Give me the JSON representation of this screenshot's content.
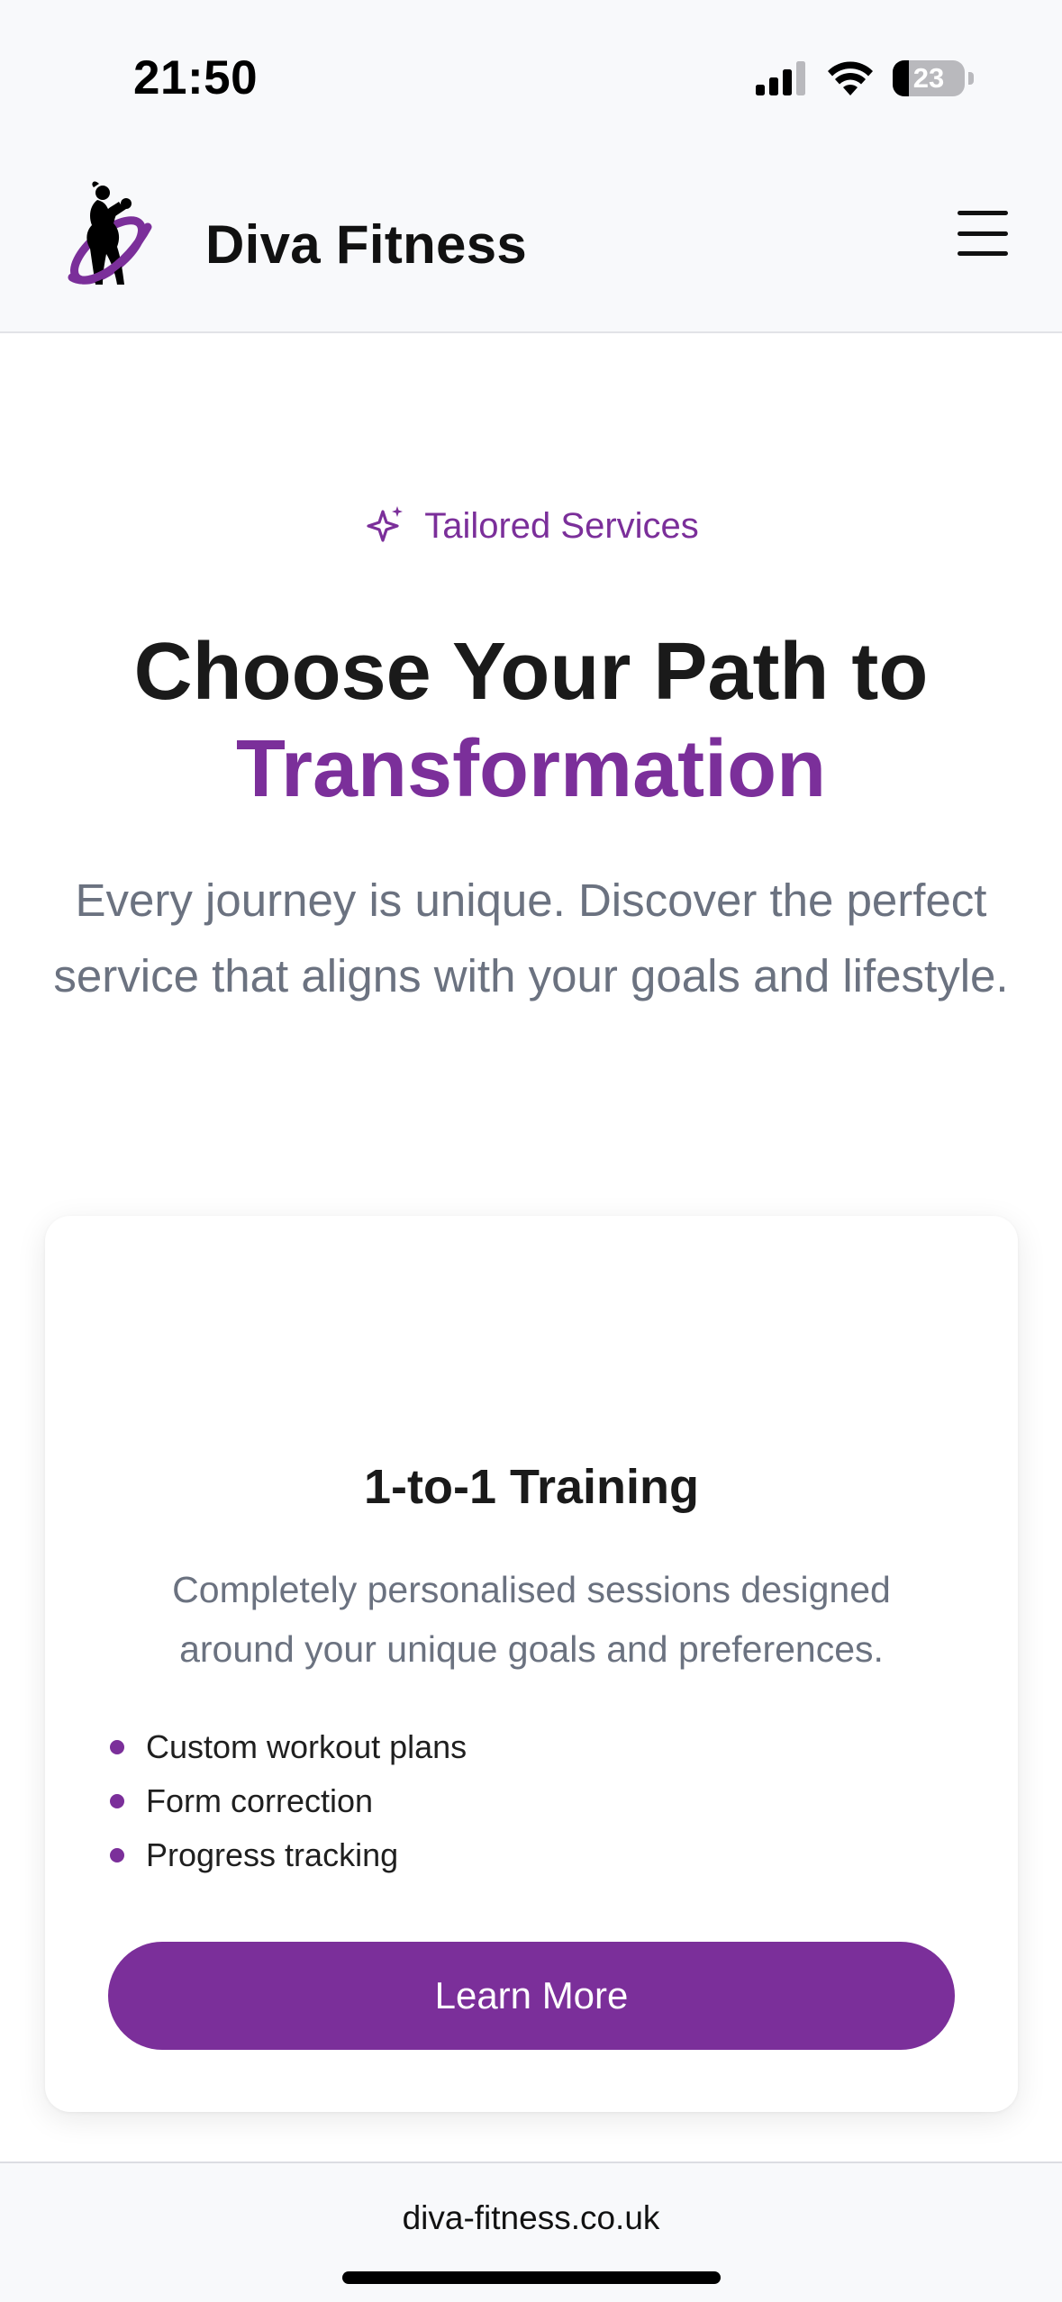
{
  "status_bar": {
    "time": "21:50",
    "battery_percent": "23",
    "battery_level": 0.23,
    "icons": [
      "cellular-signal-icon",
      "wifi-icon",
      "battery-icon"
    ]
  },
  "header": {
    "brand_name": "Diva Fitness",
    "logo_icon": "diva-fitness-logo",
    "menu_icon": "hamburger-menu-icon"
  },
  "intro": {
    "eyebrow_icon": "sparkle-icon",
    "eyebrow": "Tailored Services",
    "headline_line1": "Choose Your Path to",
    "headline_line2": "Transformation",
    "lede": "Every journey is unique. Discover the perfect service that aligns with your goals and lifestyle."
  },
  "service_card": {
    "title": "1-to-1 Training",
    "description": "Completely personalised sessions designed around your unique goals and preferences.",
    "features": [
      "Custom workout plans",
      "Form correction",
      "Progress tracking"
    ],
    "button_label": "Learn More"
  },
  "browser": {
    "url": "diva-fitness.co.uk"
  },
  "colors": {
    "accent": "#7b2f9a",
    "heading": "#1a1a1a",
    "muted_text": "#6b7280",
    "bar_background": "#f8f9fb"
  }
}
